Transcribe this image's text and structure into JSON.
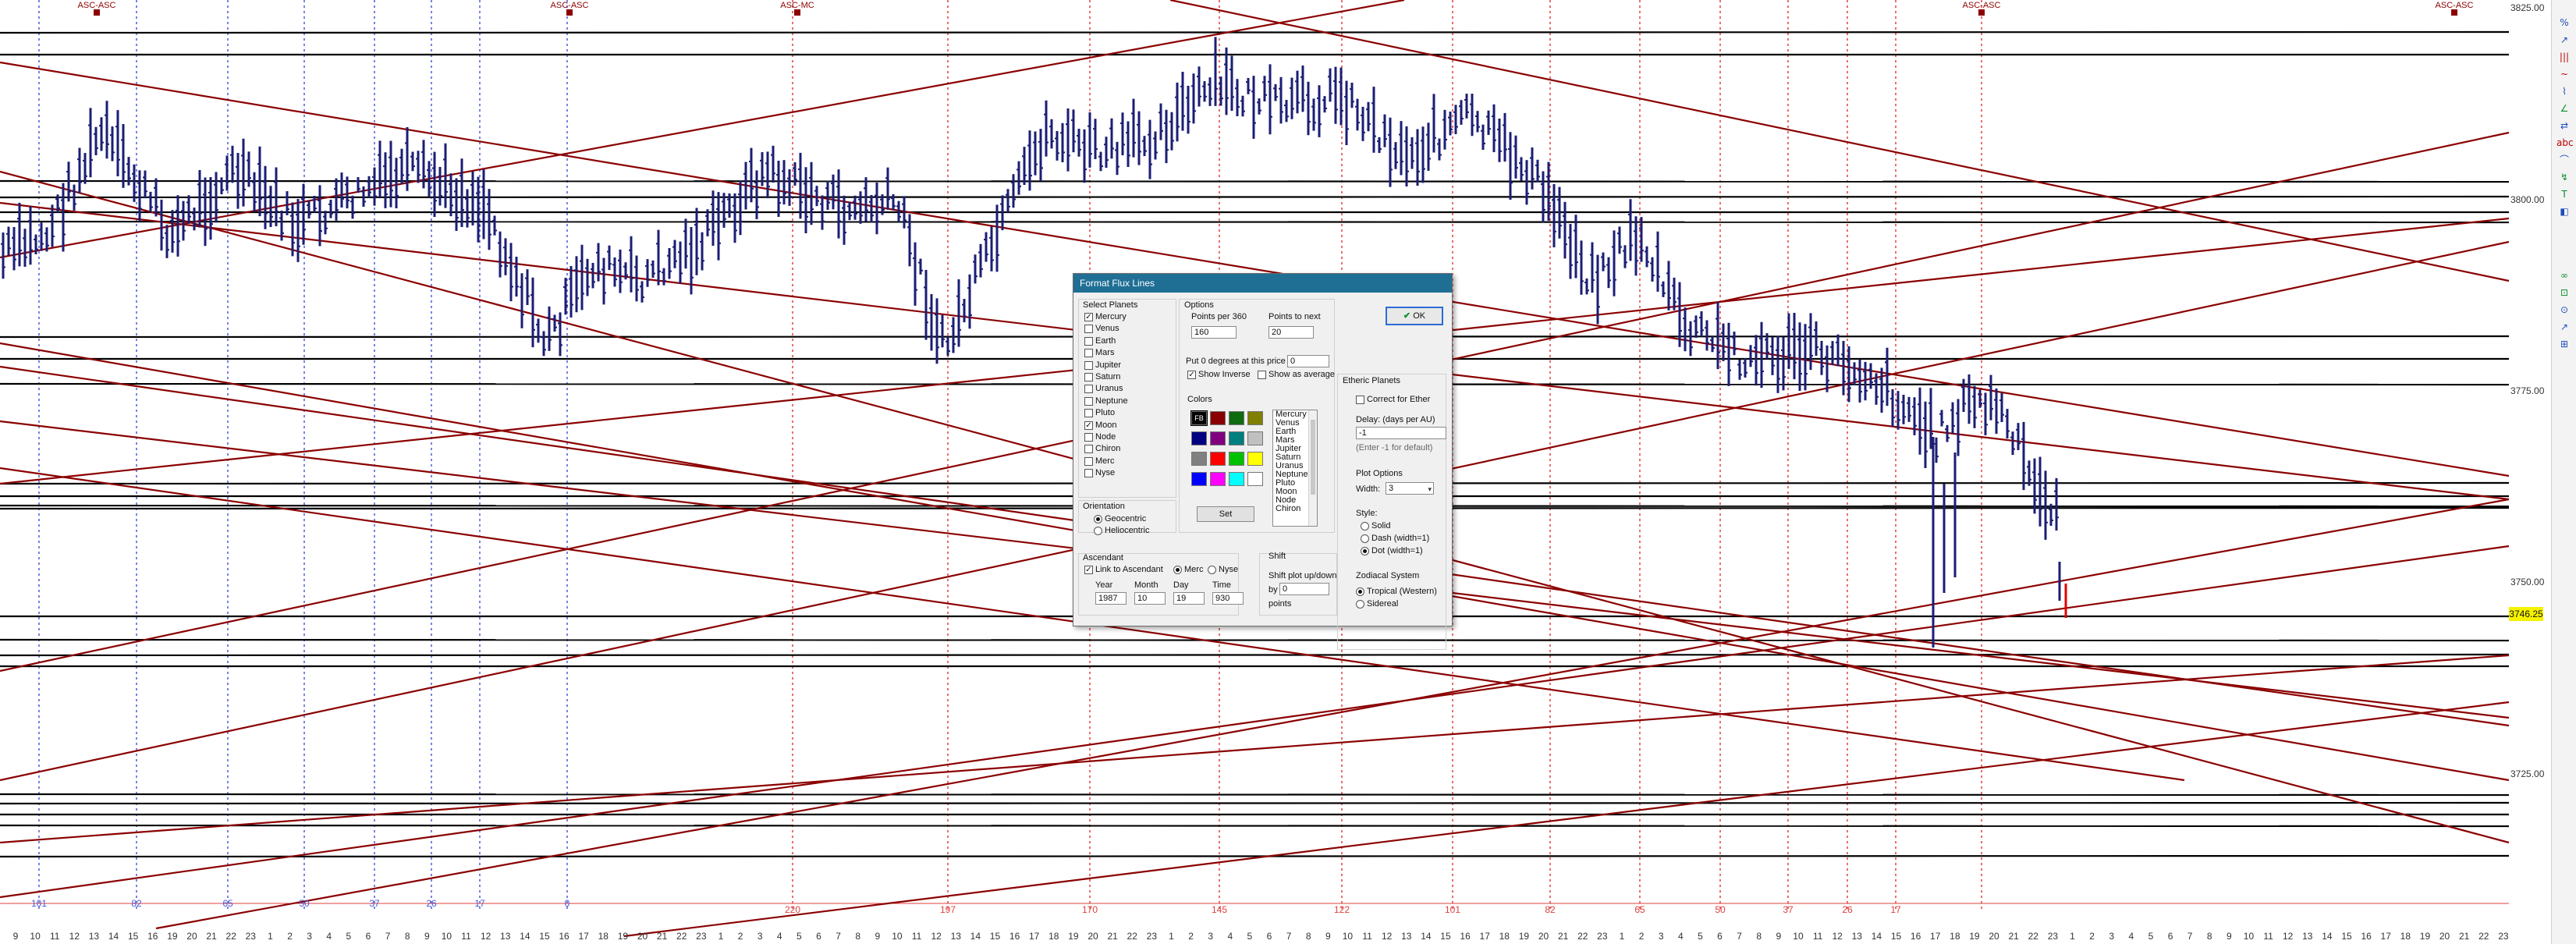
{
  "chart": {
    "price_labels": [
      "3825.00",
      "3800.00",
      "3775.00",
      "3750.00",
      "3725.00"
    ],
    "current_price": "3746.25",
    "marker_labels": [
      "ASC-ASC",
      "ASC-ASC",
      "ASC-MC",
      "ASC-ASC",
      "ASC-ASC"
    ],
    "blue_degree_labels": [
      "101",
      "82",
      "65",
      "50",
      "37",
      "26",
      "17",
      "0"
    ],
    "red_degree_labels": [
      "220",
      "197",
      "170",
      "145",
      "122",
      "101",
      "82",
      "65",
      "50",
      "37",
      "26",
      "17"
    ],
    "bottom_ticks": [
      "9",
      "10",
      "11",
      "12",
      "13",
      "14",
      "15",
      "16",
      "19",
      "20",
      "21",
      "22",
      "23",
      "1",
      "2",
      "3",
      "4",
      "5",
      "6",
      "7",
      "8",
      "9",
      "10",
      "11",
      "12",
      "13",
      "14",
      "15",
      "16",
      "17",
      "18",
      "19",
      "20",
      "21",
      "22",
      "23",
      "1",
      "2",
      "3",
      "4",
      "5",
      "6",
      "7",
      "8",
      "9",
      "10",
      "11",
      "12",
      "13",
      "14",
      "15",
      "16",
      "17",
      "18",
      "19",
      "20",
      "21",
      "22",
      "23",
      "1",
      "2",
      "3",
      "4",
      "5",
      "6",
      "7",
      "8",
      "9",
      "10",
      "11",
      "12",
      "13",
      "14",
      "15",
      "16",
      "17",
      "18",
      "19",
      "20",
      "21",
      "22",
      "23",
      "1",
      "2",
      "3",
      "4",
      "5",
      "6",
      "7",
      "8",
      "9",
      "10",
      "11",
      "12",
      "13",
      "14",
      "15",
      "16",
      "17",
      "18",
      "19",
      "20",
      "21",
      "22",
      "23",
      "1",
      "2",
      "3",
      "4",
      "5",
      "6",
      "7",
      "8",
      "9",
      "10",
      "11",
      "12",
      "13",
      "14",
      "15",
      "16",
      "17",
      "18",
      "19",
      "20",
      "21",
      "22",
      "23"
    ],
    "colors": {
      "bars": "#1b1e74",
      "flux": "#8b0000",
      "level": "#000000",
      "blue_marker": "#4b5bd8",
      "red_marker": "#e04040"
    }
  },
  "dialog": {
    "title": "Format Flux Lines",
    "select_planets_label": "Select Planets",
    "planets": [
      {
        "name": "Mercury",
        "checked": true
      },
      {
        "name": "Venus",
        "checked": false
      },
      {
        "name": "Earth",
        "checked": false
      },
      {
        "name": "Mars",
        "checked": false
      },
      {
        "name": "Jupiter",
        "checked": false
      },
      {
        "name": "Saturn",
        "checked": false
      },
      {
        "name": "Uranus",
        "checked": false
      },
      {
        "name": "Neptune",
        "checked": false
      },
      {
        "name": "Pluto",
        "checked": false
      },
      {
        "name": "Moon",
        "checked": true
      },
      {
        "name": "Node",
        "checked": false
      },
      {
        "name": "Chiron",
        "checked": false
      },
      {
        "name": "Merc",
        "checked": false
      },
      {
        "name": "Nyse",
        "checked": false
      }
    ],
    "orientation_label": "Orientation",
    "geocentric_label": "Geocentric",
    "heliocentric_label": "Heliocentric",
    "options_label": "Options",
    "points_per_360_label": "Points per 360",
    "points_per_360_value": "160",
    "points_to_next_label": "Points to next",
    "points_to_next_value": "20",
    "put_zero_label": "Put 0 degrees at this price",
    "put_zero_value": "0",
    "show_inverse_label": "Show Inverse",
    "show_average_label": "Show as average",
    "colors_label": "Colors",
    "swatch_colors": [
      "#000000",
      "#8b0000",
      "#0f6b0f",
      "#7f7f00",
      "#000080",
      "#800080",
      "#007f7f",
      "#c0c0c0",
      "#808080",
      "#ff0000",
      "#00c000",
      "#ffff00",
      "#0000ff",
      "#ff00ff",
      "#00ffff",
      "#ffffff"
    ],
    "selected_swatch_text": "FB",
    "color_list": [
      "Mercury",
      "Venus",
      "Earth",
      "Mars",
      "Jupiter",
      "Saturn",
      "Uranus",
      "Neptune",
      "Pluto",
      "Moon",
      "Node",
      "Chiron"
    ],
    "set_button": "Set",
    "ok_button": "OK",
    "etheric_label": "Etheric Planets",
    "correct_ether_label": "Correct for Ether",
    "delay_label": "Delay: (days per AU)",
    "delay_value": "-1",
    "delay_hint": "(Enter -1 for default)",
    "plot_options_label": "Plot Options",
    "width_label": "Width:",
    "width_value": "3",
    "style_label": "Style:",
    "style_solid": "Solid",
    "style_dash": "Dash (width=1)",
    "style_dot": "Dot (width=1)",
    "ascendant_label": "Ascendant",
    "link_ascendant_label": "Link to Ascendant",
    "merc_label": "Merc",
    "nyse_label": "Nyse",
    "year_label": "Year",
    "year_value": "1987",
    "month_label": "Month",
    "month_value": "10",
    "day_label": "Day",
    "day_value": "19",
    "time_label": "Time",
    "time_value": "930",
    "shift_label": "Shift",
    "shift_plot_label": "Shift plot up/down",
    "by_label": "by",
    "shift_value": "0",
    "points_label": "points",
    "zodiacal_label": "Zodiacal System",
    "tropical_label": "Tropical (Western)",
    "sidereal_label": "Sidereal"
  },
  "toolbar": {
    "tools": [
      "%",
      "↗",
      "|||",
      "~",
      "⌇",
      "∠",
      "⇄",
      "abc",
      "⌒",
      "↯",
      "T",
      "◧",
      "∞",
      "⊡",
      "⊙",
      "↗",
      "⊞"
    ]
  }
}
